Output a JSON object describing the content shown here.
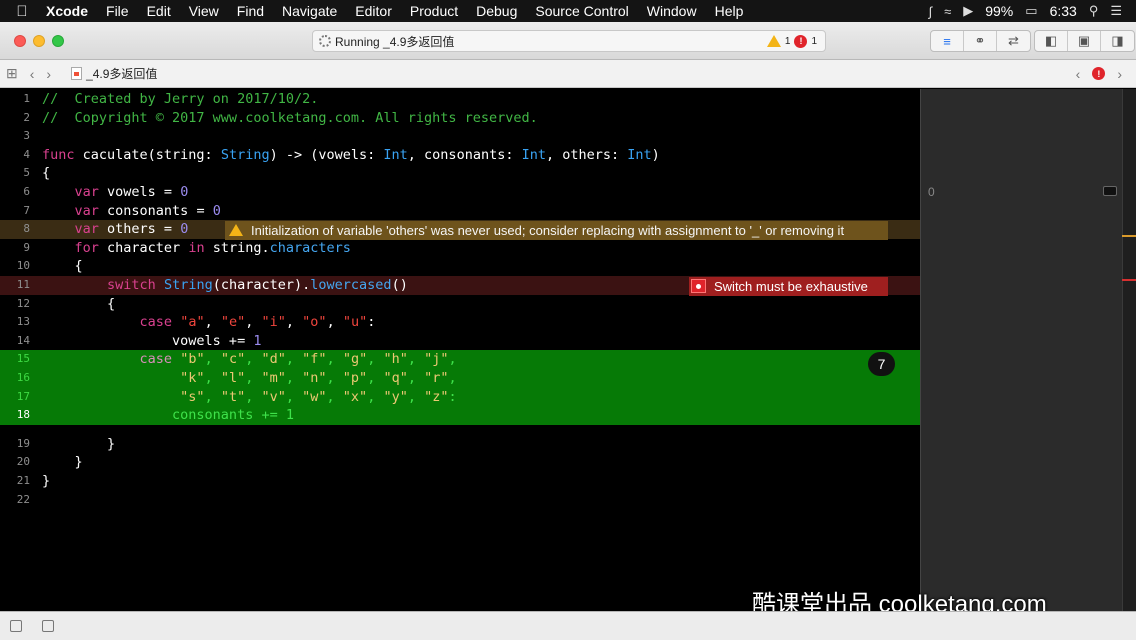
{
  "menubar": {
    "apple": "",
    "app": "Xcode",
    "items": [
      "File",
      "Edit",
      "View",
      "Find",
      "Navigate",
      "Editor",
      "Product",
      "Debug",
      "Source Control",
      "Window",
      "Help"
    ],
    "battery": "99%",
    "time": "6:33"
  },
  "toolbar": {
    "status": "Running _4.9多返回值",
    "warnings": "1",
    "errors": "1"
  },
  "jumpbar": {
    "file": "_4.9多返回值"
  },
  "editor": {
    "lines": [
      {
        "n": "1",
        "code": "//  Created by Jerry on 2017/10/2."
      },
      {
        "n": "2",
        "code": "//  Copyright © 2017 www.coolketang.com. All rights reserved."
      },
      {
        "n": "3",
        "code": ""
      },
      {
        "n": "4",
        "code": "func caculate(string: String) -> (vowels: Int, consonants: Int, others: Int)"
      },
      {
        "n": "5",
        "code": "{"
      },
      {
        "n": "6",
        "code": "    var vowels = 0"
      },
      {
        "n": "7",
        "code": "    var consonants = 0"
      },
      {
        "n": "8",
        "code": "    var others = 0"
      },
      {
        "n": "9",
        "code": "    for character in string.characters"
      },
      {
        "n": "10",
        "code": "    {"
      },
      {
        "n": "11",
        "code": "        switch String(character).lowercased()"
      },
      {
        "n": "12",
        "code": "        {"
      },
      {
        "n": "13",
        "code": "            case \"a\", \"e\", \"i\", \"o\", \"u\":"
      },
      {
        "n": "14",
        "code": "                vowels += 1"
      },
      {
        "n": "15",
        "code": "            case \"b\", \"c\", \"d\", \"f\", \"g\", \"h\", \"j\","
      },
      {
        "n": "16",
        "code": "                 \"k\", \"l\", \"m\", \"n\", \"p\", \"q\", \"r\","
      },
      {
        "n": "17",
        "code": "                 \"s\", \"t\", \"v\", \"w\", \"x\", \"y\", \"z\":"
      },
      {
        "n": "18",
        "code": "                consonants += 1"
      },
      {
        "n": "19",
        "code": "        }"
      },
      {
        "n": "20",
        "code": "    }"
      },
      {
        "n": "21",
        "code": "}"
      },
      {
        "n": "22",
        "code": ""
      }
    ],
    "warning_message": "Initialization of variable 'others' was never used; consider replacing with assignment to '_' or removing it",
    "error_message": "Switch must be exhaustive",
    "count_badge": "7"
  },
  "results": {
    "value": "0"
  },
  "watermark": "酷课堂出品 coolketang.com",
  "colors": {
    "keyword": "#d9418f",
    "type": "#39a3f3",
    "number": "#9b8cf0",
    "string": "#f0453d",
    "comment": "#41b645",
    "highlight": "#067a06",
    "warning": "#f3b417",
    "error": "#e0242b"
  }
}
